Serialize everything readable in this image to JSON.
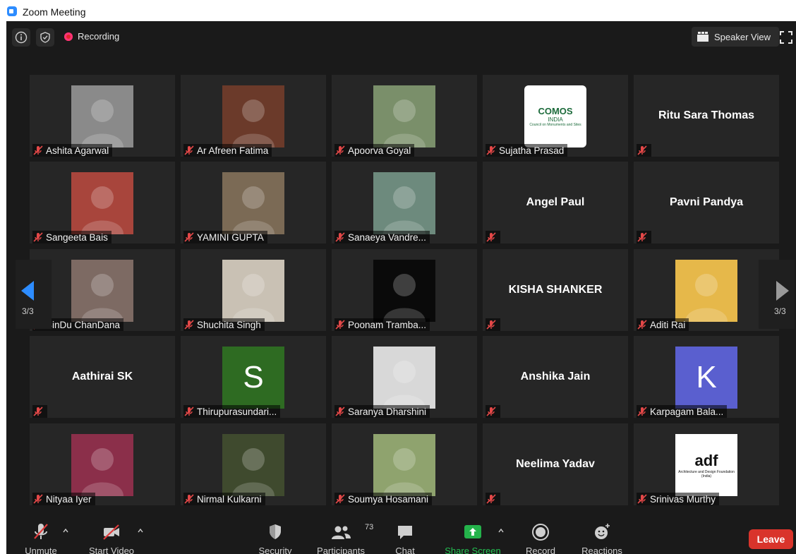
{
  "window": {
    "title": "Zoom Meeting"
  },
  "topbar": {
    "recording_label": "Recording",
    "speaker_view_label": "Speaker View"
  },
  "colors": {
    "accent": "#2d8cff",
    "leave": "#d9342b",
    "share": "#24b34b",
    "tile": "#262626",
    "background": "#1a1a1a"
  },
  "pagination": {
    "page": "3/3"
  },
  "participants": [
    {
      "name": "Ashita Agarwal",
      "type": "photo"
    },
    {
      "name": "Ar Afreen Fatima",
      "type": "photo"
    },
    {
      "name": "Apoorva Goyal",
      "type": "photo"
    },
    {
      "name": "Sujatha Prasad",
      "type": "logo",
      "logo_line1": "COMOS",
      "logo_line2": "INDIA",
      "logo_line3": "Council on Monuments and Sites"
    },
    {
      "name": "Ritu Sara Thomas",
      "type": "name"
    },
    {
      "name": "Sangeeta Bais",
      "type": "logo"
    },
    {
      "name": "YAMINI GUPTA",
      "type": "photo"
    },
    {
      "name": "Sanaeya Vandre...",
      "type": "photo"
    },
    {
      "name": "Angel Paul",
      "type": "name"
    },
    {
      "name": "Pavni Pandya",
      "type": "name"
    },
    {
      "name": "BinDu ChanDana",
      "type": "photo"
    },
    {
      "name": "Shuchita Singh",
      "type": "photo"
    },
    {
      "name": "Poonam Tramba...",
      "type": "logo"
    },
    {
      "name": "KISHA SHANKER",
      "type": "name"
    },
    {
      "name": "Aditi Rai",
      "type": "photo"
    },
    {
      "name": "Aathirai SK",
      "type": "name"
    },
    {
      "name": "Thirupurasundari...",
      "type": "avatar",
      "initial": "S",
      "color": "#2e6b22"
    },
    {
      "name": "Saranya Dharshini",
      "type": "photo"
    },
    {
      "name": "Anshika Jain",
      "type": "name"
    },
    {
      "name": "Karpagam Bala...",
      "type": "avatar",
      "initial": "K",
      "color": "#5a5fcf"
    },
    {
      "name": "Nityaa Iyer",
      "type": "photo"
    },
    {
      "name": "Nirmal Kulkarni",
      "type": "photo"
    },
    {
      "name": "Soumya Hosamani",
      "type": "photo"
    },
    {
      "name": "Neelima Yadav",
      "type": "name"
    },
    {
      "name": "Srinivas Murthy",
      "type": "logo",
      "logo_text": "adf",
      "logo_caption": "Architecture and Design Foundation (India)"
    }
  ],
  "toolbar": {
    "unmute": "Unmute",
    "start_video": "Start Video",
    "security": "Security",
    "participants": "Participants",
    "participants_count": "73",
    "chat": "Chat",
    "share_screen": "Share Screen",
    "record": "Record",
    "reactions": "Reactions",
    "leave": "Leave"
  }
}
